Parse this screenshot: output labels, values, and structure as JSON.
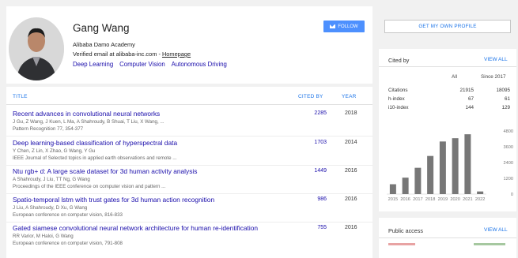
{
  "profile": {
    "name": "Gang Wang",
    "affiliation": "Alibaba Damo Academy",
    "email_text": "Verified email at alibaba-inc.com - ",
    "homepage_label": "Homepage",
    "interests": [
      "Deep Learning",
      "Computer Vision",
      "Autonomous Driving"
    ],
    "follow_label": "FOLLOW"
  },
  "table": {
    "headers": {
      "title": "TITLE",
      "cited_by": "CITED BY",
      "year": "YEAR"
    },
    "rows": [
      {
        "title": "Recent advances in convolutional neural networks",
        "authors": "J Gu, Z Wang, J Kuen, L Ma, A Shahroudy, B Shuai, T Liu, X Wang, ...",
        "venue": "Pattern Recognition 77, 354-377",
        "cited_by": "2285",
        "year": "2018"
      },
      {
        "title": "Deep learning-based classification of hyperspectral data",
        "authors": "Y Chen, Z Lin, X Zhao, G Wang, Y Gu",
        "venue": "IEEE Journal of Selected topics in applied earth observations and remote ...",
        "cited_by": "1703",
        "year": "2014"
      },
      {
        "title": "Ntu rgb+ d: A large scale dataset for 3d human activity analysis",
        "authors": "A Shahroudy, J Liu, TT Ng, G Wang",
        "venue": "Proceedings of the IEEE conference on computer vision and pattern ...",
        "cited_by": "1449",
        "year": "2016"
      },
      {
        "title": "Spatio-temporal lstm with trust gates for 3d human action recognition",
        "authors": "J Liu, A Shahroudy, D Xu, G Wang",
        "venue": "European conference on computer vision, 816-833",
        "cited_by": "986",
        "year": "2016"
      },
      {
        "title": "Gated siamese convolutional neural network architecture for human re-identification",
        "authors": "RR Varior, M Haloi, G Wang",
        "venue": "European conference on computer vision, 791-808",
        "cited_by": "755",
        "year": "2016"
      }
    ]
  },
  "sidebar": {
    "get_profile_label": "GET MY OWN PROFILE",
    "cited_by": {
      "title": "Cited by",
      "view_all": "VIEW ALL",
      "col_all": "All",
      "col_since": "Since 2017",
      "stats": [
        {
          "label": "Citations",
          "all": "21915",
          "since": "18095"
        },
        {
          "label": "h-index",
          "all": "67",
          "since": "61"
        },
        {
          "label": "i10-index",
          "all": "144",
          "since": "129"
        }
      ]
    },
    "public_access": {
      "title": "Public access",
      "view_all": "VIEW ALL"
    }
  },
  "chart_data": {
    "type": "bar",
    "categories": [
      "2015",
      "2016",
      "2017",
      "2018",
      "2019",
      "2020",
      "2021",
      "2022"
    ],
    "values": [
      750,
      1250,
      2000,
      2900,
      4000,
      4250,
      4550,
      200
    ],
    "ylim": [
      0,
      4800
    ],
    "yticks": [
      "0",
      "1200",
      "2400",
      "3600",
      "4800"
    ],
    "bar_color": "#777777",
    "grid": false
  },
  "colors": {
    "link": "#1a0dab",
    "accent": "#1a73e8",
    "follow_button": "#4d90fe"
  },
  "icons": {
    "follow": "envelope-icon"
  }
}
